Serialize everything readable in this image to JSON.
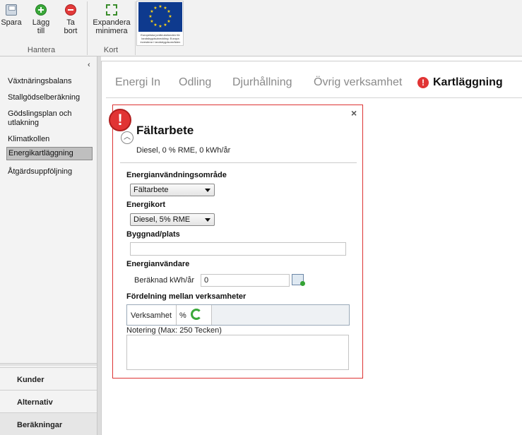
{
  "ribbon": {
    "groups": [
      {
        "label": "Hantera",
        "buttons": [
          {
            "label": "Spara",
            "icon": "save-icon"
          },
          {
            "label": "Lägg till",
            "icon": "add-icon"
          },
          {
            "label": "Ta bort",
            "icon": "remove-icon"
          }
        ]
      },
      {
        "label": "Kort",
        "buttons": [
          {
            "label": "Expandera minimera",
            "icon": "expand-icon"
          }
        ]
      }
    ],
    "eu_caption": "Europeiska jordbruksfonden för landsbygdsutveckling: Europa investerar i landsbygdsområden"
  },
  "sidebar": {
    "items": [
      {
        "label": "Växtnäringsbalans"
      },
      {
        "label": "Stallgödselberäkning"
      },
      {
        "label": "Gödslingsplan och utlakning"
      },
      {
        "label": "Klimatkollen"
      },
      {
        "label": "Energikartläggning",
        "selected": true
      },
      {
        "label": "Åtgärdsuppföljning"
      }
    ],
    "sections": [
      "Kunder",
      "Alternativ",
      "Beräkningar"
    ]
  },
  "tabs": [
    "Energi In",
    "Odling",
    "Djurhållning",
    "Övrig verksamhet",
    "Kartläggning"
  ],
  "active_tab": "Kartläggning",
  "card": {
    "title": "Fältarbete",
    "subtitle": "Diesel, 0 % RME, 0 kWh/år",
    "fields": {
      "area_label": "Energianvändningsområde",
      "area_value": "Fältarbete",
      "card_label": "Energikort",
      "card_value": "Diesel, 5% RME",
      "building_label": "Byggnad/plats",
      "building_value": "",
      "user_label": "Energianvändare",
      "calc_label": "Beräknad kWh/år",
      "calc_value": "0",
      "dist_label": "Fördelning mellan verksamheter",
      "dist_col1": "Verksamhet",
      "dist_col2": "%",
      "note_label": "Notering (Max: 250 Tecken)",
      "note_value": ""
    }
  },
  "colors": {
    "alert": "#e13434",
    "card_border": "#dd3333",
    "selected": "#bfbfbf"
  }
}
